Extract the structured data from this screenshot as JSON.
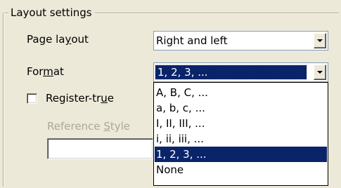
{
  "group": {
    "title": "Layout settings"
  },
  "page_layout": {
    "label_pre": "Page la",
    "label_mn": "y",
    "label_post": "out",
    "value": "Right and left"
  },
  "format": {
    "label_pre": "For",
    "label_mn": "m",
    "label_post": "at",
    "value": "1, 2, 3, ...",
    "options": [
      "A, B, C, ...",
      "a, b, c, ...",
      "I, II, III, ...",
      "i, ii, iii, ...",
      "1, 2, 3, ...",
      "None"
    ],
    "selected_index": 4
  },
  "register_true": {
    "label_pre": "Register-tr",
    "label_mn": "u",
    "label_post": "e",
    "checked": false
  },
  "reference_style": {
    "label_pre": "Reference ",
    "label_mn": "S",
    "label_post": "tyle",
    "value": ""
  },
  "colors": {
    "dialog_bg": "#ece9d8",
    "selection": "#0a246a",
    "disabled_text": "#aca899"
  },
  "icons": {
    "dropdown": "chevron-down-icon"
  }
}
